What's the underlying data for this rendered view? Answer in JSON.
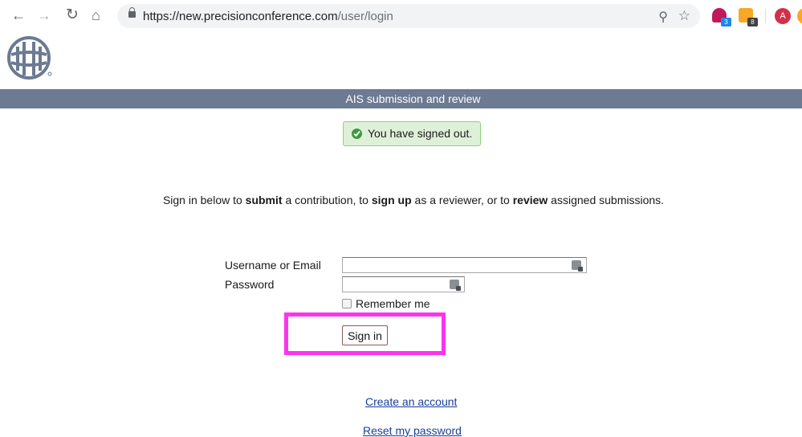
{
  "browser": {
    "url_host": "https://new.precisionconference.com",
    "url_path": "/user/login",
    "extensions": [
      {
        "name": "extension-1",
        "badge": "3"
      },
      {
        "name": "extension-2",
        "badge": "8"
      }
    ],
    "profile_initial": "A"
  },
  "header": {
    "banner_title": "AIS submission and review"
  },
  "alert": {
    "message": "You have signed out."
  },
  "intro": {
    "part1": "Sign in below to ",
    "bold1": "submit",
    "part2": " a contribution, to ",
    "bold2": "sign up",
    "part3": " as a reviewer, or to ",
    "bold3": "review",
    "part4": " assigned submissions."
  },
  "form": {
    "username_label": "Username or Email",
    "username_value": "",
    "password_label": "Password",
    "password_value": "",
    "remember_label": "Remember me",
    "remember_checked": false,
    "signin_label": "Sign in"
  },
  "links": {
    "create_account": "Create an account",
    "reset_password": "Reset my password"
  },
  "colors": {
    "banner_bg": "#6c7a92",
    "alert_bg": "#dff0d8",
    "alert_border": "#8fcf7e",
    "highlight": "#ff33ee",
    "link": "#1a3d99"
  }
}
